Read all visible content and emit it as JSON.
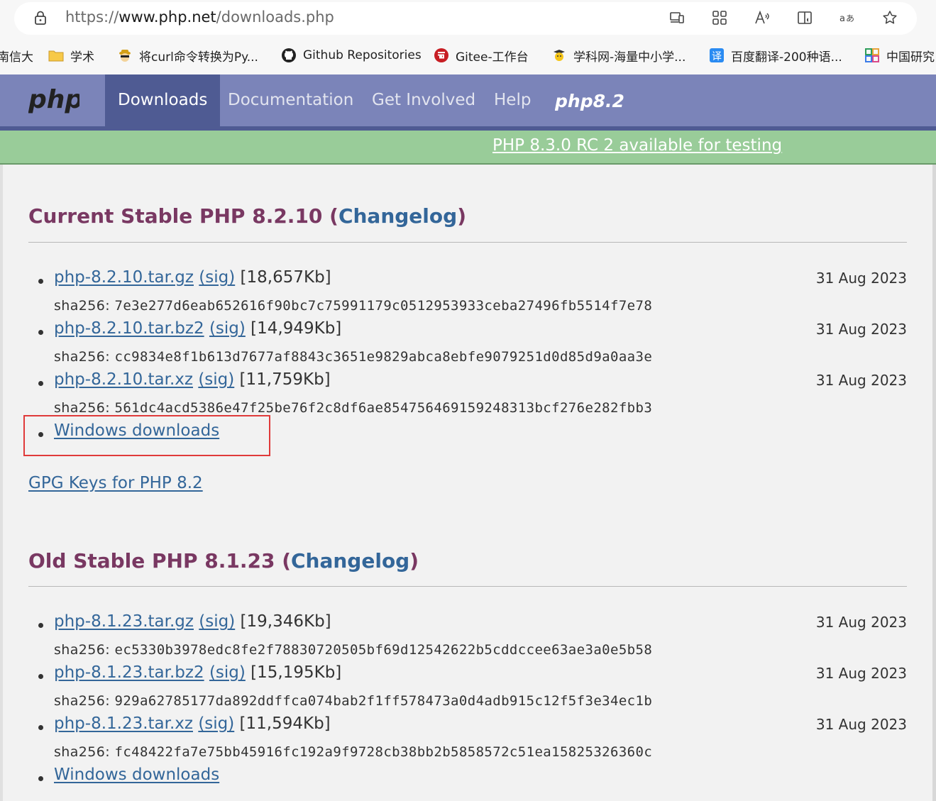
{
  "browser": {
    "url_prefix": "https://",
    "url_host": "www.php.net",
    "url_path": "/downloads.php",
    "toolbar_icons": [
      "devices-icon",
      "apps-icon",
      "read-aloud-icon",
      "immersive-reader-icon",
      "translate-icon",
      "favorite-star-icon"
    ]
  },
  "bookmarks": [
    {
      "label": "南信大",
      "icon": "none"
    },
    {
      "label": "学术",
      "icon": "folder-icon"
    },
    {
      "label": "将curl命令转换为Py...",
      "icon": "spy-icon"
    },
    {
      "label": "Github Repositories",
      "icon": "github-icon"
    },
    {
      "label": "Gitee-工作台",
      "icon": "gitee-icon"
    },
    {
      "label": "学科网-海量中小学...",
      "icon": "zxxk-icon"
    },
    {
      "label": "百度翻译-200种语...",
      "icon": "baidu-translate-icon"
    },
    {
      "label": "中国研究",
      "icon": "cnki-icon"
    }
  ],
  "nav": {
    "logo": "php",
    "items": [
      "Downloads",
      "Documentation",
      "Get Involved",
      "Help"
    ],
    "version_logo": "php8.2"
  },
  "announcement": "PHP 8.3.0 RC 2 available for testing",
  "sections": [
    {
      "title_prefix": "Current Stable PHP 8.2.10 (",
      "changelog": "Changelog",
      "title_suffix": ")",
      "downloads": [
        {
          "file": "php-8.2.10.tar.gz",
          "sig": "(sig)",
          "size": "[18,657Kb]",
          "date": "31 Aug 2023",
          "sha_label": "sha256: ",
          "sha": "7e3e277d6eab652616f90bc7c75991179c0512953933ceba27496fb5514f7e78"
        },
        {
          "file": "php-8.2.10.tar.bz2",
          "sig": "(sig)",
          "size": "[14,949Kb]",
          "date": "31 Aug 2023",
          "sha_label": "sha256: ",
          "sha": "cc9834e8f1b613d7677af8843c3651e9829abca8ebfe9079251d0d85d9a0aa3e"
        },
        {
          "file": "php-8.2.10.tar.xz",
          "sig": "(sig)",
          "size": "[11,759Kb]",
          "date": "31 Aug 2023",
          "sha_label": "sha256: ",
          "sha": "561dc4acd5386e47f25be76f2c8df6ae85475646915924 8313bcf276e282fbb3"
        }
      ],
      "windows": "Windows downloads",
      "gpg": "GPG Keys for PHP 8.2"
    },
    {
      "title_prefix": "Old Stable PHP 8.1.23 (",
      "changelog": "Changelog",
      "title_suffix": ")",
      "downloads": [
        {
          "file": "php-8.1.23.tar.gz",
          "sig": "(sig)",
          "size": "[19,346Kb]",
          "date": "31 Aug 2023",
          "sha_label": "sha256: ",
          "sha": "ec5330b3978edc8fe2f78830720505bf69d12542622b5cddccee63ae3a0e5b58"
        },
        {
          "file": "php-8.1.23.tar.bz2",
          "sig": "(sig)",
          "size": "[15,195Kb]",
          "date": "31 Aug 2023",
          "sha_label": "sha256: ",
          "sha": "929a62785177da892ddffca074bab2f1ff578473a0d4adb915c12f5f3e34ec1b"
        },
        {
          "file": "php-8.1.23.tar.xz",
          "sig": "(sig)",
          "size": "[11,594Kb]",
          "date": "31 Aug 2023",
          "sha_label": "sha256: ",
          "sha": "fc48422fa7e75bb45916fc192a9f9728cb38bb2b5858572c51ea15825326360c"
        }
      ],
      "windows": "Windows downloads"
    }
  ],
  "colors": {
    "nav_bg": "#7b84b9",
    "nav_active": "#4f5b93",
    "announce_bg": "#99cc99",
    "title": "#793862",
    "link": "#336699",
    "highlight_box": "#e03a3a"
  }
}
